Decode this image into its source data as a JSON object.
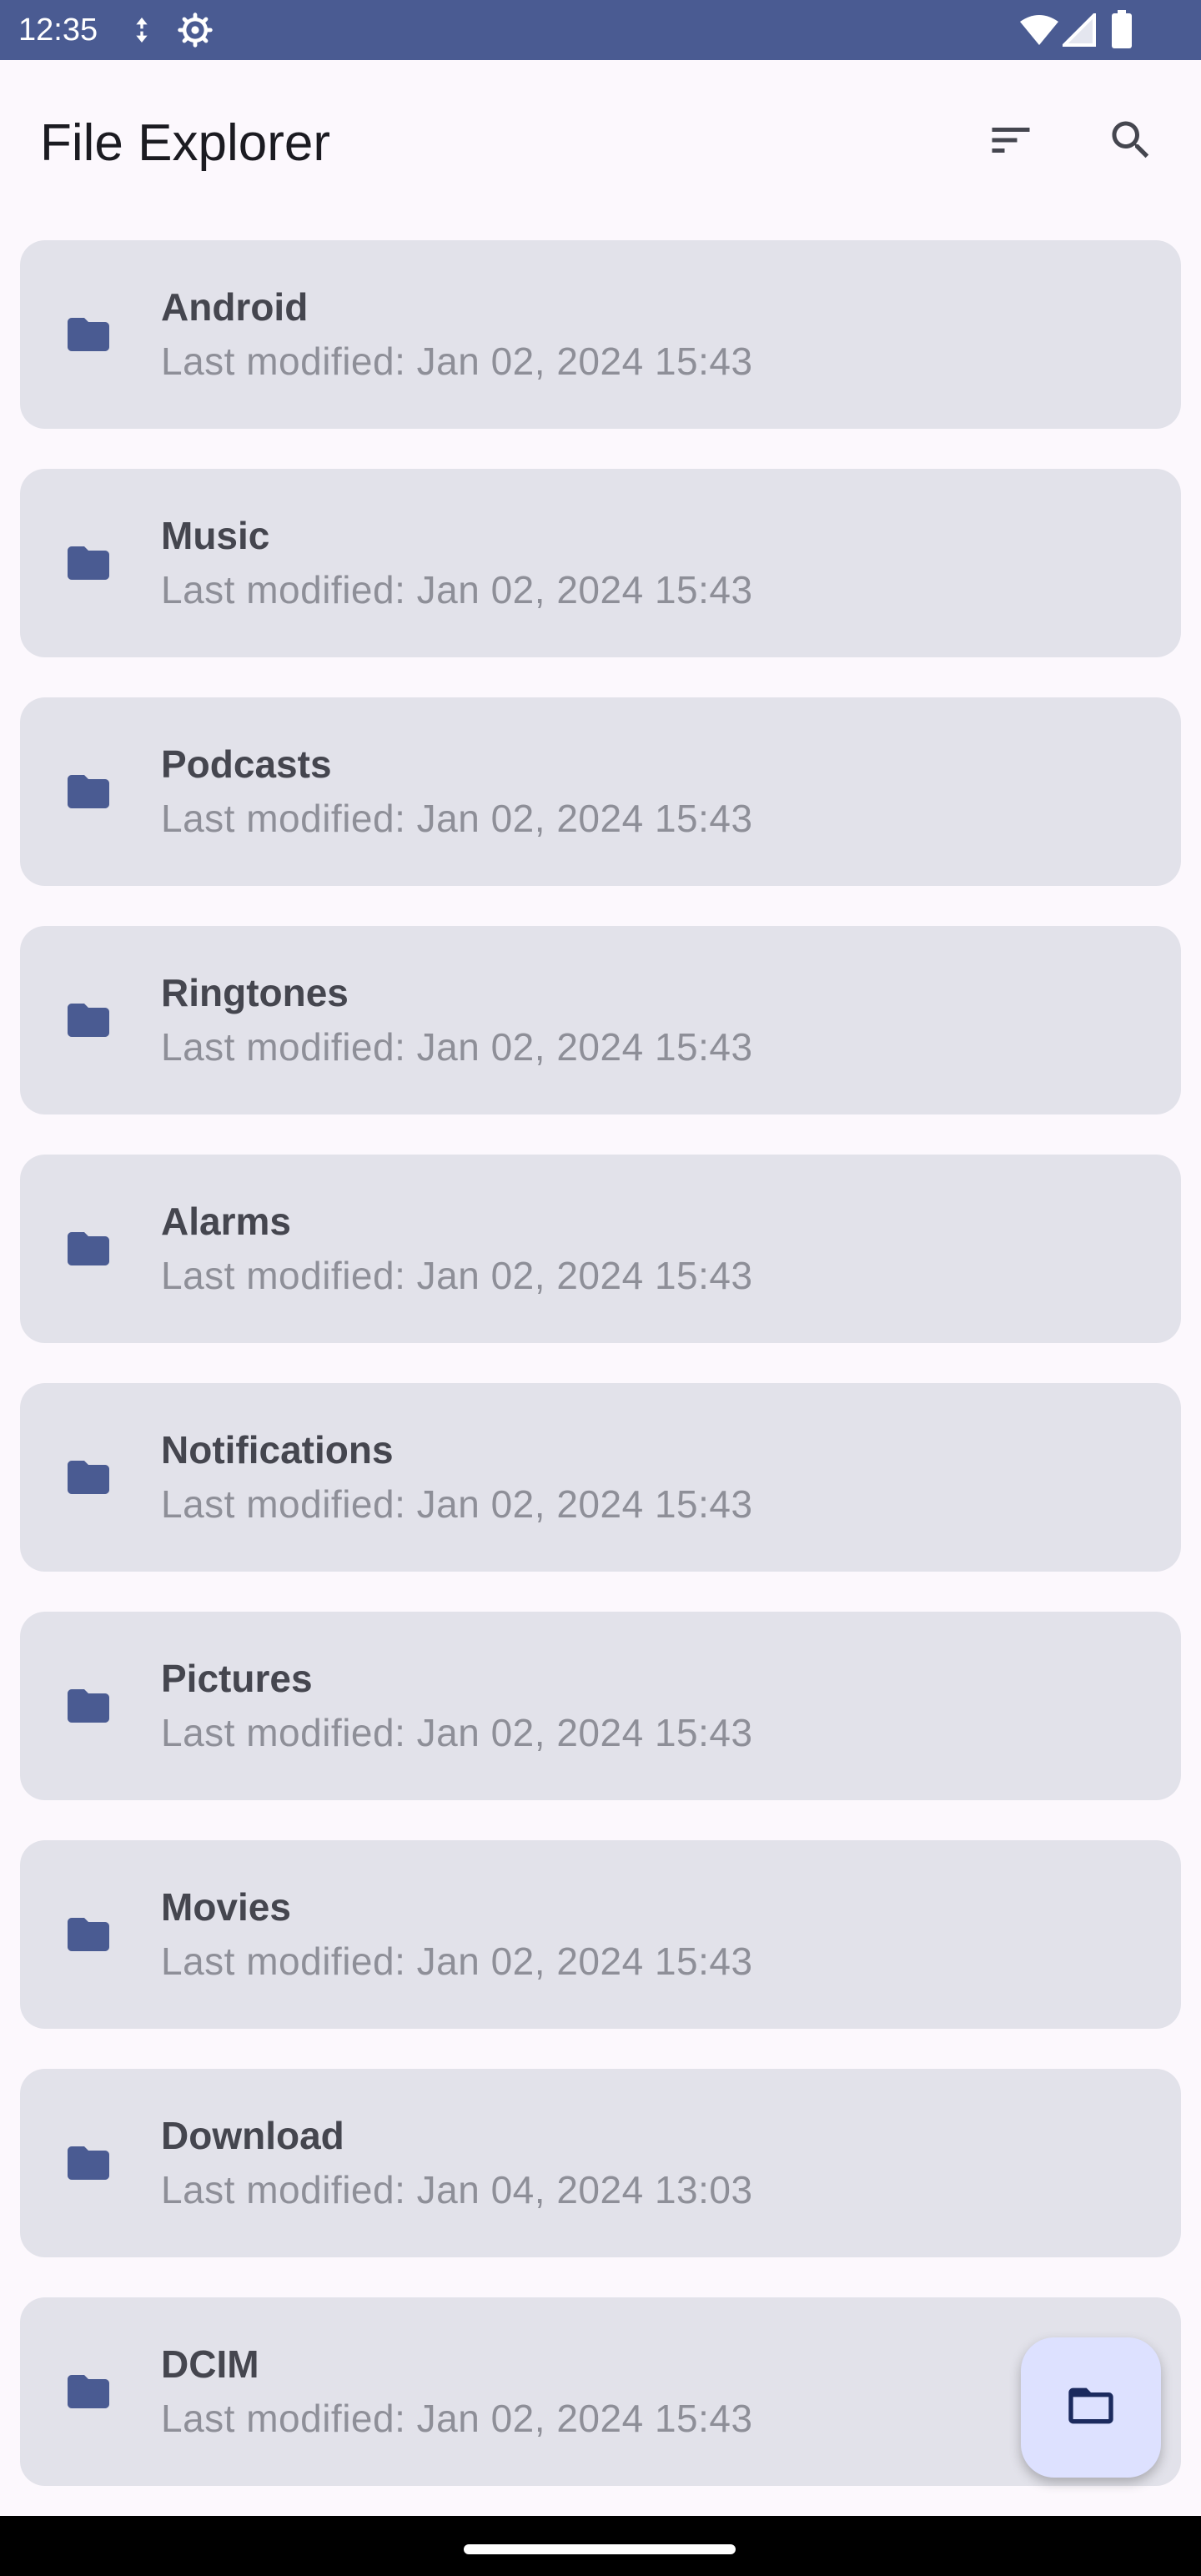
{
  "status_bar": {
    "time": "12:35",
    "icons": [
      "data-saver-icon",
      "settings-gear-icon",
      "wifi-icon",
      "cell-signal-icon",
      "battery-icon"
    ]
  },
  "app_bar": {
    "title": "File Explorer",
    "actions": [
      "sort-icon",
      "search-icon"
    ]
  },
  "folders": [
    {
      "name": "Android",
      "modified": "Last modified: Jan 02, 2024 15:43"
    },
    {
      "name": "Music",
      "modified": "Last modified: Jan 02, 2024 15:43"
    },
    {
      "name": "Podcasts",
      "modified": "Last modified: Jan 02, 2024 15:43"
    },
    {
      "name": "Ringtones",
      "modified": "Last modified: Jan 02, 2024 15:43"
    },
    {
      "name": "Alarms",
      "modified": "Last modified: Jan 02, 2024 15:43"
    },
    {
      "name": "Notifications",
      "modified": "Last modified: Jan 02, 2024 15:43"
    },
    {
      "name": "Pictures",
      "modified": "Last modified: Jan 02, 2024 15:43"
    },
    {
      "name": "Movies",
      "modified": "Last modified: Jan 02, 2024 15:43"
    },
    {
      "name": "Download",
      "modified": "Last modified: Jan 04, 2024 13:03"
    },
    {
      "name": "DCIM",
      "modified": "Last modified: Jan 02, 2024 15:43"
    }
  ],
  "fab": {
    "icon": "folder-outline-icon"
  },
  "colors": {
    "primary": "#4a5b92",
    "card_background": "#e2e2ea",
    "fab_background": "#dde1ff",
    "page_background": "#fcf8fd"
  }
}
